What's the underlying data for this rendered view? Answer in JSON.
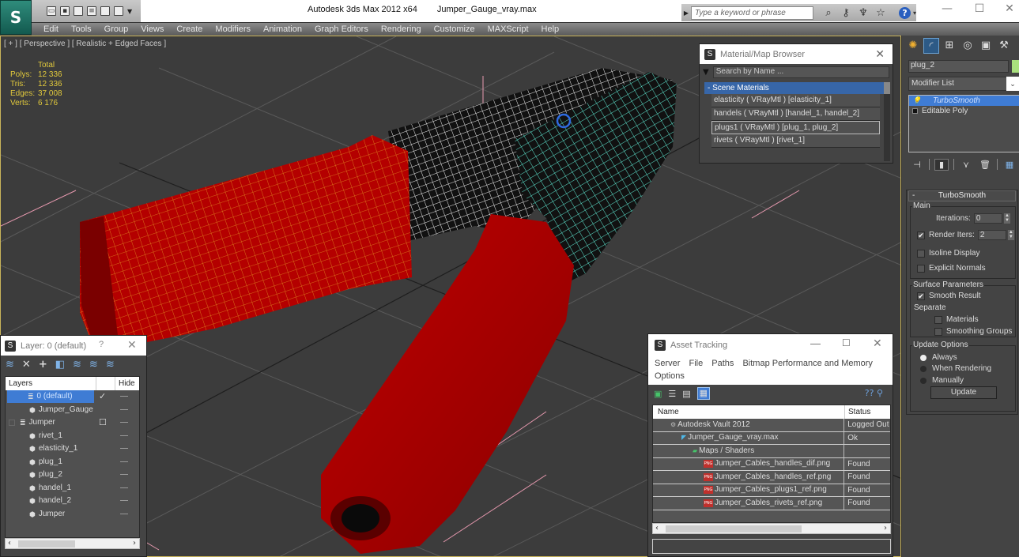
{
  "titlebar": {
    "app_logo": "3ds Max logo",
    "app_title": "Autodesk 3ds Max  2012 x64",
    "file_name": "Jumper_Gauge_vray.max",
    "search_placeholder": "Type a keyword or phrase",
    "quick_access": [
      "new",
      "open",
      "save",
      "undo",
      "redo",
      "project",
      "more"
    ]
  },
  "menubar": {
    "items": [
      "Edit",
      "Tools",
      "Group",
      "Views",
      "Create",
      "Modifiers",
      "Animation",
      "Graph Editors",
      "Rendering",
      "Customize",
      "MAXScript",
      "Help"
    ]
  },
  "viewport": {
    "label": "[ + ] [ Perspective ] [ Realistic + Edged Faces ]",
    "stats": {
      "header": "Total",
      "rows": [
        {
          "label": "Polys:",
          "value": "12 336"
        },
        {
          "label": "Tris:",
          "value": "12 336"
        },
        {
          "label": "Edges:",
          "value": "37 008"
        },
        {
          "label": "Verts:",
          "value": "6 176"
        }
      ]
    }
  },
  "material_browser": {
    "title": "Material/Map Browser",
    "search_placeholder": "Search by Name ...",
    "section": "- Scene Materials",
    "items": [
      "elasticity  ( VRayMtl ) [elasticity_1]",
      "handels  ( VRayMtl ) [handel_1, handel_2]",
      "plugs1  ( VRayMtl ) [plug_1, plug_2]",
      "rivets  ( VRayMtl ) [rivet_1]"
    ],
    "selected_index": 2
  },
  "command_panel": {
    "object_name": "plug_2",
    "object_color": "#a9e07e",
    "modifier_list_label": "Modifier List",
    "stack": [
      {
        "label": "TurboSmooth",
        "selected": true
      },
      {
        "label": "Editable Poly",
        "selected": false
      }
    ],
    "rollout": {
      "title": "TurboSmooth",
      "main_group": "Main",
      "iterations_label": "Iterations:",
      "iterations_value": "0",
      "render_iters_label": "Render Iters:",
      "render_iters_value": "2",
      "render_iters_checked": true,
      "isoline_label": "Isoline Display",
      "isoline_checked": false,
      "explicit_normals_label": "Explicit Normals",
      "explicit_normals_checked": false,
      "surface_group": "Surface Parameters",
      "smooth_result_label": "Smooth Result",
      "smooth_result_checked": true,
      "separate_label": "Separate",
      "materials_label": "Materials",
      "materials_checked": false,
      "smoothing_groups_label": "Smoothing Groups",
      "smoothing_groups_checked": false,
      "update_group": "Update Options",
      "update_options": [
        "Always",
        "When Rendering",
        "Manually"
      ],
      "update_selected": "Always",
      "update_button": "Update"
    }
  },
  "layer_dialog": {
    "title": "Layer: 0 (default)",
    "help": "?",
    "columns": [
      "Layers",
      "",
      "Hide"
    ],
    "rows": [
      {
        "name": "0 (default)",
        "type": "layer",
        "selected": true,
        "active": "✓"
      },
      {
        "name": "Jumper_Gauge",
        "type": "object"
      },
      {
        "name": "Jumper",
        "type": "layer",
        "active": "☐"
      },
      {
        "name": "rivet_1",
        "type": "object"
      },
      {
        "name": "elasticity_1",
        "type": "object"
      },
      {
        "name": "plug_1",
        "type": "object"
      },
      {
        "name": "plug_2",
        "type": "object"
      },
      {
        "name": "handel_1",
        "type": "object"
      },
      {
        "name": "handel_2",
        "type": "object"
      },
      {
        "name": "Jumper",
        "type": "object"
      }
    ]
  },
  "asset_tracking": {
    "title": "Asset Tracking",
    "menu": [
      "Server",
      "File",
      "Paths",
      "Bitmap Performance and Memory",
      "Options"
    ],
    "columns": [
      "Name",
      "Status"
    ],
    "rows": [
      {
        "name": "Autodesk Vault 2012",
        "status": "Logged Out",
        "icon": "vault-icon",
        "indent": 1
      },
      {
        "name": "Jumper_Gauge_vray.max",
        "status": "Ok",
        "icon": "max-file-icon",
        "indent": 2
      },
      {
        "name": "Maps / Shaders",
        "status": "",
        "icon": "maps-folder-icon",
        "indent": 3
      },
      {
        "name": "Jumper_Cables_handles_dif.png",
        "status": "Found",
        "icon": "png-icon",
        "indent": 4
      },
      {
        "name": "Jumper_Cables_handles_ref.png",
        "status": "Found",
        "icon": "png-icon",
        "indent": 4
      },
      {
        "name": "Jumper_Cables_plugs1_ref.png",
        "status": "Found",
        "icon": "png-icon",
        "indent": 4
      },
      {
        "name": "Jumper_Cables_rivets_ref.png",
        "status": "Found",
        "icon": "png-icon",
        "indent": 4
      }
    ]
  },
  "colors": {
    "accent_blue": "#3f7cd4",
    "stats_yellow": "#e1c93c",
    "plug_red": "#b00000",
    "wire_cyan": "#5ee6d0",
    "wire_orange": "#e08a20"
  }
}
